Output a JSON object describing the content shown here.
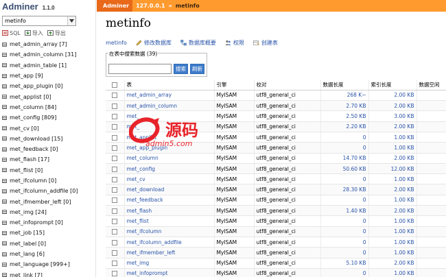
{
  "sidebar": {
    "brand": "Adminer",
    "version": "1.1.0",
    "database_value": "metinfo",
    "links": [
      "SQL",
      "导入",
      "导出"
    ],
    "tables": [
      "met_admin_array [7]",
      "met_admin_column [31]",
      "met_admin_table [1]",
      "met_app [9]",
      "met_app_plugin [0]",
      "met_applist [0]",
      "met_column [84]",
      "met_config [809]",
      "met_cv [0]",
      "met_download [15]",
      "met_feedback [0]",
      "met_flash [17]",
      "met_flist [0]",
      "met_ifcolumn [0]",
      "met_ifcolumn_addfile [0]",
      "met_ifmember_left [0]",
      "met_img [24]",
      "met_infoprompt [0]",
      "met_job [15]",
      "met_label [0]",
      "met_lang [6]",
      "met_language [999+]",
      "met_link [7]"
    ]
  },
  "topbar": {
    "brand": "Adminer",
    "server": "127.0.0.1",
    "separator": "»",
    "database": "metinfo"
  },
  "main": {
    "title": "metinfo",
    "actions": [
      "metinfo",
      "修改数据库",
      "数据库概要",
      "权限",
      "创建表"
    ],
    "search": {
      "legend": "在表中搜索数据 (39)",
      "input_value": "",
      "search_label": "搜索",
      "refresh_label": "刷新"
    },
    "columns": [
      "表",
      "引擎",
      "校对",
      "数据长度",
      "索引长度",
      "数据空闲"
    ],
    "rows": [
      {
        "name": "met_admin_array",
        "engine": "MyISAM",
        "collation": "utf8_general_ci",
        "data": "268 K~",
        "index": "2.00 KB"
      },
      {
        "name": "met_admin_column",
        "engine": "MyISAM",
        "collation": "utf8_general_ci",
        "data": "2.70 KB",
        "index": "2.00 KB"
      },
      {
        "name": "met_",
        "engine": "MyISAM",
        "collation": "utf8_general_ci",
        "data": "2.50 KB",
        "index": "3.00 KB"
      },
      {
        "name": "met_",
        "engine": "MyISAM",
        "collation": "utf8_general_ci",
        "data": "2.20 KB",
        "index": "2.00 KB"
      },
      {
        "name": "met_applist",
        "engine": "MyISAM",
        "collation": "utf8_general_ci",
        "data": "0",
        "index": "1.00 KB"
      },
      {
        "name": "met_app_plugin",
        "engine": "MyISAM",
        "collation": "utf8_general_ci",
        "data": "0",
        "index": "1.00 KB"
      },
      {
        "name": "met_column",
        "engine": "MyISAM",
        "collation": "utf8_general_ci",
        "data": "14.70 KB",
        "index": "2.00 KB"
      },
      {
        "name": "met_config",
        "engine": "MyISAM",
        "collation": "utf8_general_ci",
        "data": "50.60 KB",
        "index": "12.00 KB"
      },
      {
        "name": "met_cv",
        "engine": "MyISAM",
        "collation": "utf8_general_ci",
        "data": "0",
        "index": "1.00 KB"
      },
      {
        "name": "met_download",
        "engine": "MyISAM",
        "collation": "utf8_general_ci",
        "data": "28.30 KB",
        "index": "2.00 KB"
      },
      {
        "name": "met_feedback",
        "engine": "MyISAM",
        "collation": "utf8_general_ci",
        "data": "0",
        "index": "1.00 KB"
      },
      {
        "name": "met_flash",
        "engine": "MyISAM",
        "collation": "utf8_general_ci",
        "data": "1.40 KB",
        "index": "2.00 KB"
      },
      {
        "name": "met_flist",
        "engine": "MyISAM",
        "collation": "utf8_general_ci",
        "data": "0",
        "index": "1.00 KB"
      },
      {
        "name": "met_ifcolumn",
        "engine": "MyISAM",
        "collation": "utf8_general_ci",
        "data": "0",
        "index": "1.00 KB"
      },
      {
        "name": "met_ifcolumn_addfile",
        "engine": "MyISAM",
        "collation": "utf8_general_ci",
        "data": "0",
        "index": "1.00 KB"
      },
      {
        "name": "met_ifmember_left",
        "engine": "MyISAM",
        "collation": "utf8_general_ci",
        "data": "0",
        "index": "1.00 KB"
      },
      {
        "name": "met_img",
        "engine": "MyISAM",
        "collation": "utf8_general_ci",
        "data": "5.10 KB",
        "index": "2.00 KB"
      },
      {
        "name": "met_infoprompt",
        "engine": "MyISAM",
        "collation": "utf8_general_ci",
        "data": "0",
        "index": "1.00 KB"
      }
    ]
  },
  "watermark": {
    "logo_text": "源码",
    "domain": "admin5.com"
  },
  "colors": {
    "topbar": "#ff9a2e",
    "topbar_brand": "#e9691a",
    "link": "#2953a8",
    "button": "#3f7cc9",
    "watermark": "#e8232a"
  }
}
